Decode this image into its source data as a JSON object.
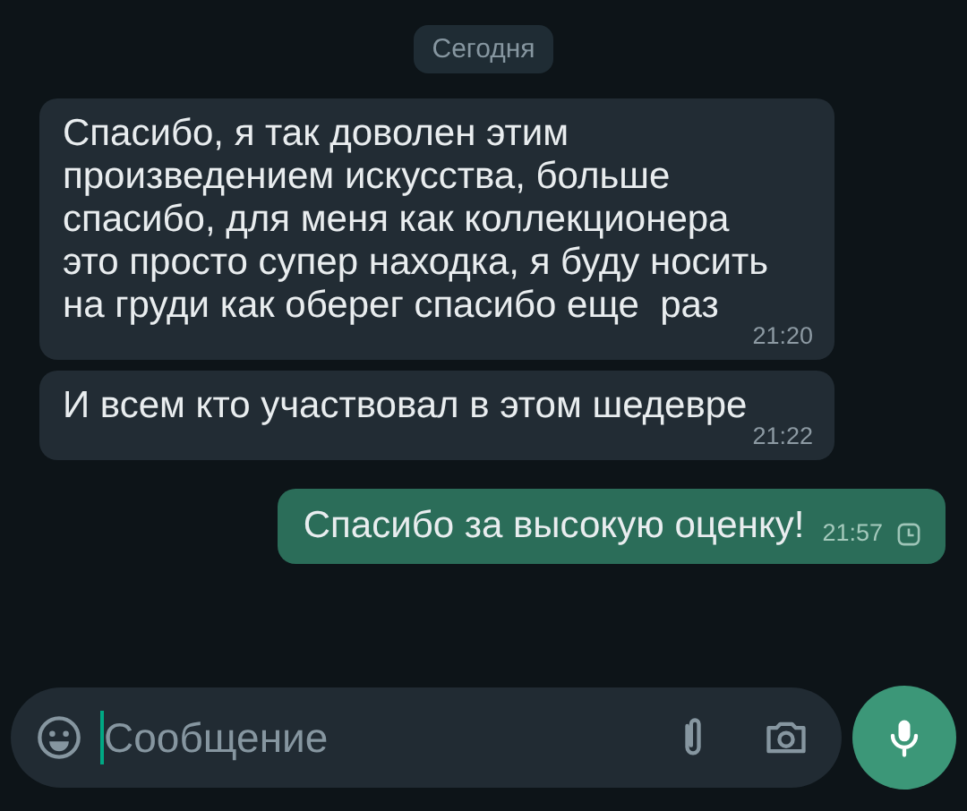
{
  "date_chip": "Сегодня",
  "messages": [
    {
      "kind": "incoming",
      "text": "Спасибо, я так доволен этим произведением искусства, больше спасибо, для меня как коллекционера это просто супер находка, я буду носить на груди как оберег спасибо еще  раз",
      "time": "21:20"
    },
    {
      "kind": "incoming",
      "text": "И всем кто участвовал в этом шедевре",
      "time": "21:22"
    },
    {
      "kind": "outgoing",
      "text": "Спасибо за высокую оценку!",
      "time": "21:57",
      "pending": true
    }
  ],
  "composer": {
    "placeholder": "Сообщение",
    "focused": true
  }
}
